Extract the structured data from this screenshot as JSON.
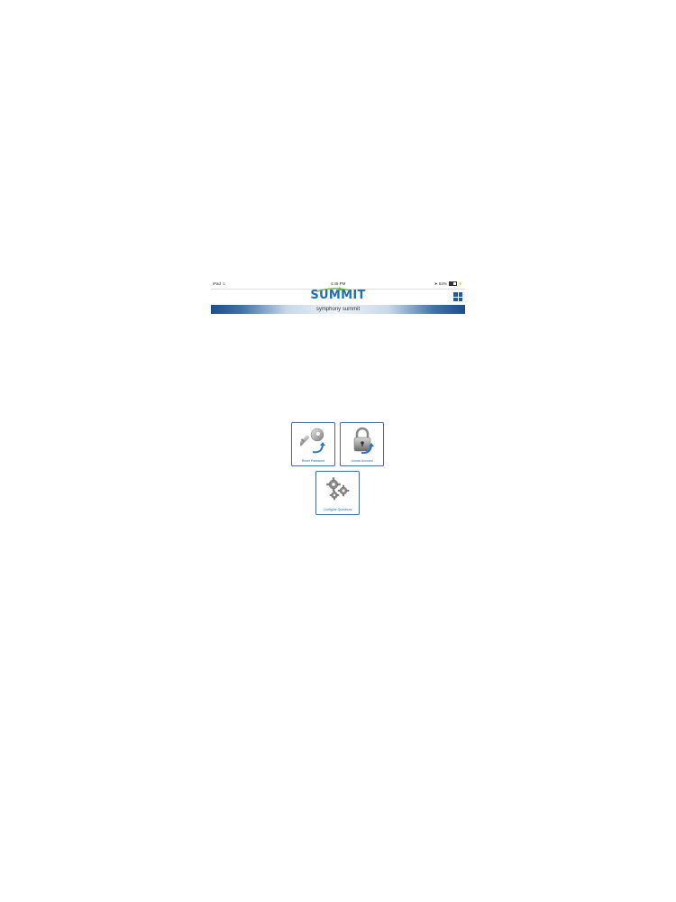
{
  "status_bar": {
    "device": "iPad",
    "time": "4:49 PM",
    "battery": "63%"
  },
  "header": {
    "logo_text": "SUMMIT",
    "banner_text": "symphony summit"
  },
  "tiles": [
    {
      "label": "Reset Password",
      "icon": "key-icon"
    },
    {
      "label": "Unlock Account",
      "icon": "padlock-icon"
    },
    {
      "label": "Configure Questions",
      "icon": "gears-icon"
    }
  ],
  "colors": {
    "accent": "#1e6db5",
    "banner_dark": "#1b4f8f",
    "tile_border": "#4a6e9c"
  }
}
